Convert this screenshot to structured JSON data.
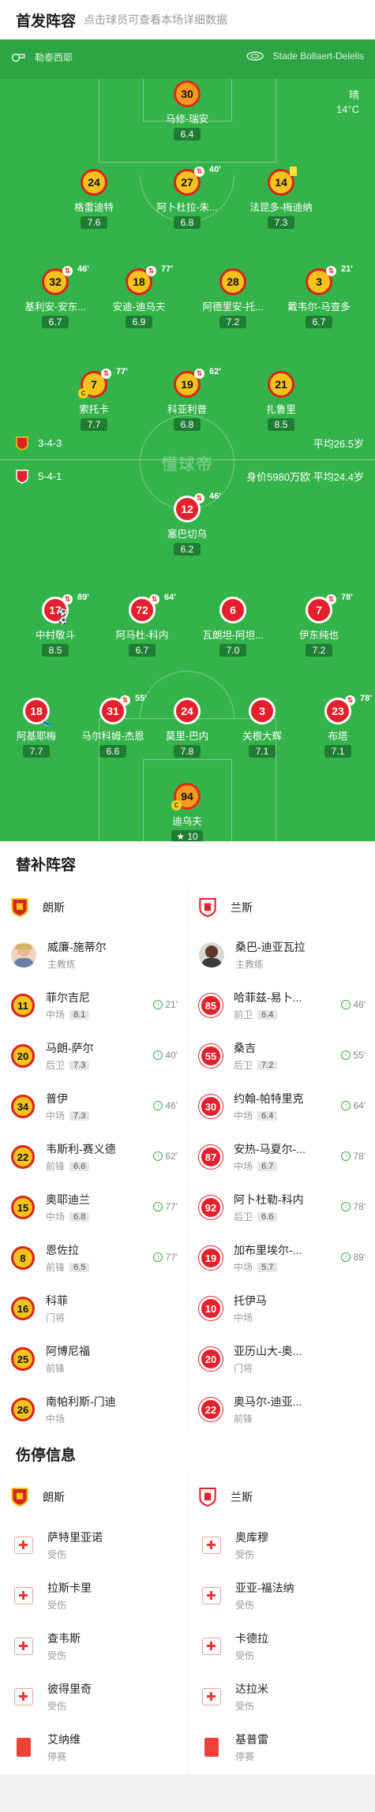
{
  "lineup_header": {
    "title": "首发阵容",
    "subtitle": "点击球员可查看本场详细数据"
  },
  "pitch": {
    "referee": "勒泰西耶",
    "stadium": "Stade Bollaert-Delelis",
    "weather": "晴",
    "temperature": "14°C",
    "watermark": "懂球帝"
  },
  "home_form": {
    "formation": "3-4-3",
    "avg_age": "平均26.5岁"
  },
  "away_form": {
    "formation": "5-4-1",
    "value_age": "身价5980万欧 平均24.4岁"
  },
  "home_players": [
    {
      "number": "30",
      "name": "马修-瑞安",
      "rating": "6.4",
      "role": "gk"
    },
    {
      "number": "24",
      "name": "格雷迪特",
      "rating": "7.6"
    },
    {
      "number": "27",
      "name": "阿卜杜拉-朱...",
      "rating": "6.8",
      "sub_minute": "40'"
    },
    {
      "number": "14",
      "name": "法昆多-梅迪纳",
      "rating": "7.3",
      "yellow": true
    },
    {
      "number": "32",
      "name": "基利安-安东...",
      "rating": "6.7",
      "sub_minute": "46'"
    },
    {
      "number": "18",
      "name": "安迪-迪乌夫",
      "rating": "6.9",
      "sub_minute": "77'"
    },
    {
      "number": "28",
      "name": "阿德里安-托...",
      "rating": "7.2"
    },
    {
      "number": "3",
      "name": "戴韦尔-马查多",
      "rating": "6.7",
      "sub_minute": "21'"
    },
    {
      "number": "7",
      "name": "索托卡",
      "rating": "7.7",
      "sub_minute": "77'",
      "captain": true
    },
    {
      "number": "19",
      "name": "科亚利普",
      "rating": "6.8",
      "sub_minute": "62'"
    },
    {
      "number": "21",
      "name": "扎鲁里",
      "rating": "8.5"
    }
  ],
  "away_players": [
    {
      "number": "12",
      "name": "塞巴切乌",
      "rating": "6.2",
      "sub_minute": "46'"
    },
    {
      "number": "17",
      "name": "中村敬斗",
      "rating": "8.5",
      "sub_minute": "89'",
      "goals": "⚽⚽"
    },
    {
      "number": "72",
      "name": "阿马杜-科内",
      "rating": "6.7",
      "sub_minute": "64'"
    },
    {
      "number": "6",
      "name": "瓦朗坦-阿坦...",
      "rating": "7.0"
    },
    {
      "number": "7",
      "name": "伊东纯也",
      "rating": "7.2",
      "sub_minute": "78'"
    },
    {
      "number": "18",
      "name": "阿基耶梅",
      "rating": "7.7",
      "assist": true
    },
    {
      "number": "31",
      "name": "马尔科姆-杰恩",
      "rating": "6.6",
      "sub_minute": "55'"
    },
    {
      "number": "24",
      "name": "莫里-巴内",
      "rating": "7.8"
    },
    {
      "number": "3",
      "name": "关根大辉",
      "rating": "7.1"
    },
    {
      "number": "23",
      "name": "布塔",
      "rating": "7.1",
      "sub_minute": "78'"
    },
    {
      "number": "94",
      "name": "迪乌夫",
      "rating": "10",
      "role": "gk",
      "captain": true,
      "star": true
    }
  ],
  "subs": {
    "title": "替补阵容",
    "home_team": "朗斯",
    "away_team": "兰斯",
    "home_coach": {
      "name": "威廉-施蒂尔",
      "role": "主教练"
    },
    "away_coach": {
      "name": "桑巴-迪亚瓦拉",
      "role": "主教练"
    },
    "home": [
      {
        "number": "11",
        "name": "菲尔吉尼",
        "pos": "中场",
        "rating": "8.1",
        "minute": "21'"
      },
      {
        "number": "20",
        "name": "马朗-萨尔",
        "pos": "后卫",
        "rating": "7.3",
        "minute": "40'"
      },
      {
        "number": "34",
        "name": "普伊",
        "pos": "中场",
        "rating": "7.3",
        "minute": "46'"
      },
      {
        "number": "22",
        "name": "韦斯利-赛义德",
        "pos": "前锋",
        "rating": "6.6",
        "minute": "62'"
      },
      {
        "number": "15",
        "name": "奥耶迪兰",
        "pos": "中场",
        "rating": "6.8",
        "minute": "77'"
      },
      {
        "number": "8",
        "name": "恩佐拉",
        "pos": "前锋",
        "rating": "6.5",
        "minute": "77'"
      },
      {
        "number": "16",
        "name": "科菲",
        "pos": "门将",
        "rating": "",
        "minute": ""
      },
      {
        "number": "25",
        "name": "阿博尼福",
        "pos": "前锋",
        "rating": "",
        "minute": ""
      },
      {
        "number": "26",
        "name": "南帕利斯-门迪",
        "pos": "中场",
        "rating": "",
        "minute": ""
      }
    ],
    "away": [
      {
        "number": "85",
        "name": "哈菲兹-易卜...",
        "pos": "前卫",
        "rating": "6.4",
        "minute": "46'"
      },
      {
        "number": "55",
        "name": "桑吉",
        "pos": "后卫",
        "rating": "7.2",
        "minute": "55'"
      },
      {
        "number": "30",
        "name": "约翰-帕特里克",
        "pos": "中场",
        "rating": "6.4",
        "minute": "64'"
      },
      {
        "number": "87",
        "name": "安热-马夏尔-...",
        "pos": "中场",
        "rating": "6.7",
        "minute": "78'"
      },
      {
        "number": "92",
        "name": "阿卜杜勒-科内",
        "pos": "后卫",
        "rating": "6.6",
        "minute": "78'"
      },
      {
        "number": "19",
        "name": "加布里埃尔-...",
        "pos": "中场",
        "rating": "5.7",
        "minute": "89'"
      },
      {
        "number": "10",
        "name": "托伊马",
        "pos": "中场",
        "rating": "",
        "minute": ""
      },
      {
        "number": "20",
        "name": "亚历山大-奥...",
        "pos": "门将",
        "rating": "",
        "minute": ""
      },
      {
        "number": "22",
        "name": "奥马尔-迪亚...",
        "pos": "前锋",
        "rating": "",
        "minute": ""
      }
    ]
  },
  "injuries": {
    "title": "伤停信息",
    "home_team": "朗斯",
    "away_team": "兰斯",
    "home": [
      {
        "name": "萨特里亚诺",
        "type": "受伤",
        "kind": "injury"
      },
      {
        "name": "拉斯卡里",
        "type": "受伤",
        "kind": "injury"
      },
      {
        "name": "查韦斯",
        "type": "受伤",
        "kind": "injury"
      },
      {
        "name": "彼得里奇",
        "type": "受伤",
        "kind": "injury"
      },
      {
        "name": "艾纳维",
        "type": "停赛",
        "kind": "suspension"
      }
    ],
    "away": [
      {
        "name": "奥库穆",
        "type": "受伤",
        "kind": "injury"
      },
      {
        "name": "亚亚-福法纳",
        "type": "受伤",
        "kind": "injury"
      },
      {
        "name": "卡德拉",
        "type": "受伤",
        "kind": "injury"
      },
      {
        "name": "达拉米",
        "type": "受伤",
        "kind": "injury"
      },
      {
        "name": "基普雷",
        "type": "停赛",
        "kind": "suspension"
      }
    ]
  }
}
